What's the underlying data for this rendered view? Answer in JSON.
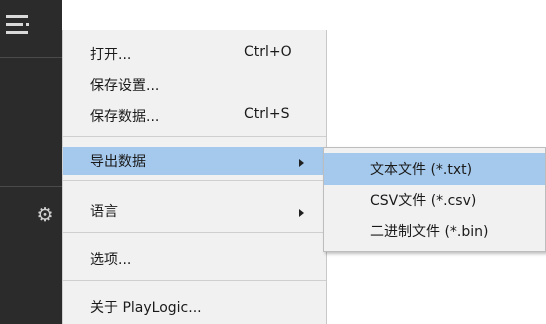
{
  "sidebar": {
    "menu_icon": "hamburger-menu-icon",
    "settings_icon": "gear-icon",
    "settings_glyph": "⚙"
  },
  "menu": {
    "items": [
      {
        "label": "打开...",
        "shortcut": "Ctrl+O"
      },
      {
        "label": "保存设置..."
      },
      {
        "label": "保存数据...",
        "shortcut": "Ctrl+S"
      },
      {
        "label": "导出数据",
        "submenu": true,
        "highlighted": true
      },
      {
        "label": "语言",
        "submenu": true
      },
      {
        "label": "选项..."
      },
      {
        "label": "关于 PlayLogic..."
      }
    ]
  },
  "export_submenu": {
    "items": [
      {
        "label": "文本文件 (*.txt)",
        "highlighted": true
      },
      {
        "label": "CSV文件 (*.csv)"
      },
      {
        "label": "二进制文件 (*.bin)"
      }
    ]
  },
  "colors": {
    "sidebar": "#2b2b2b",
    "menu_background": "#f1f1f1",
    "highlight": "#a5c9ec"
  }
}
